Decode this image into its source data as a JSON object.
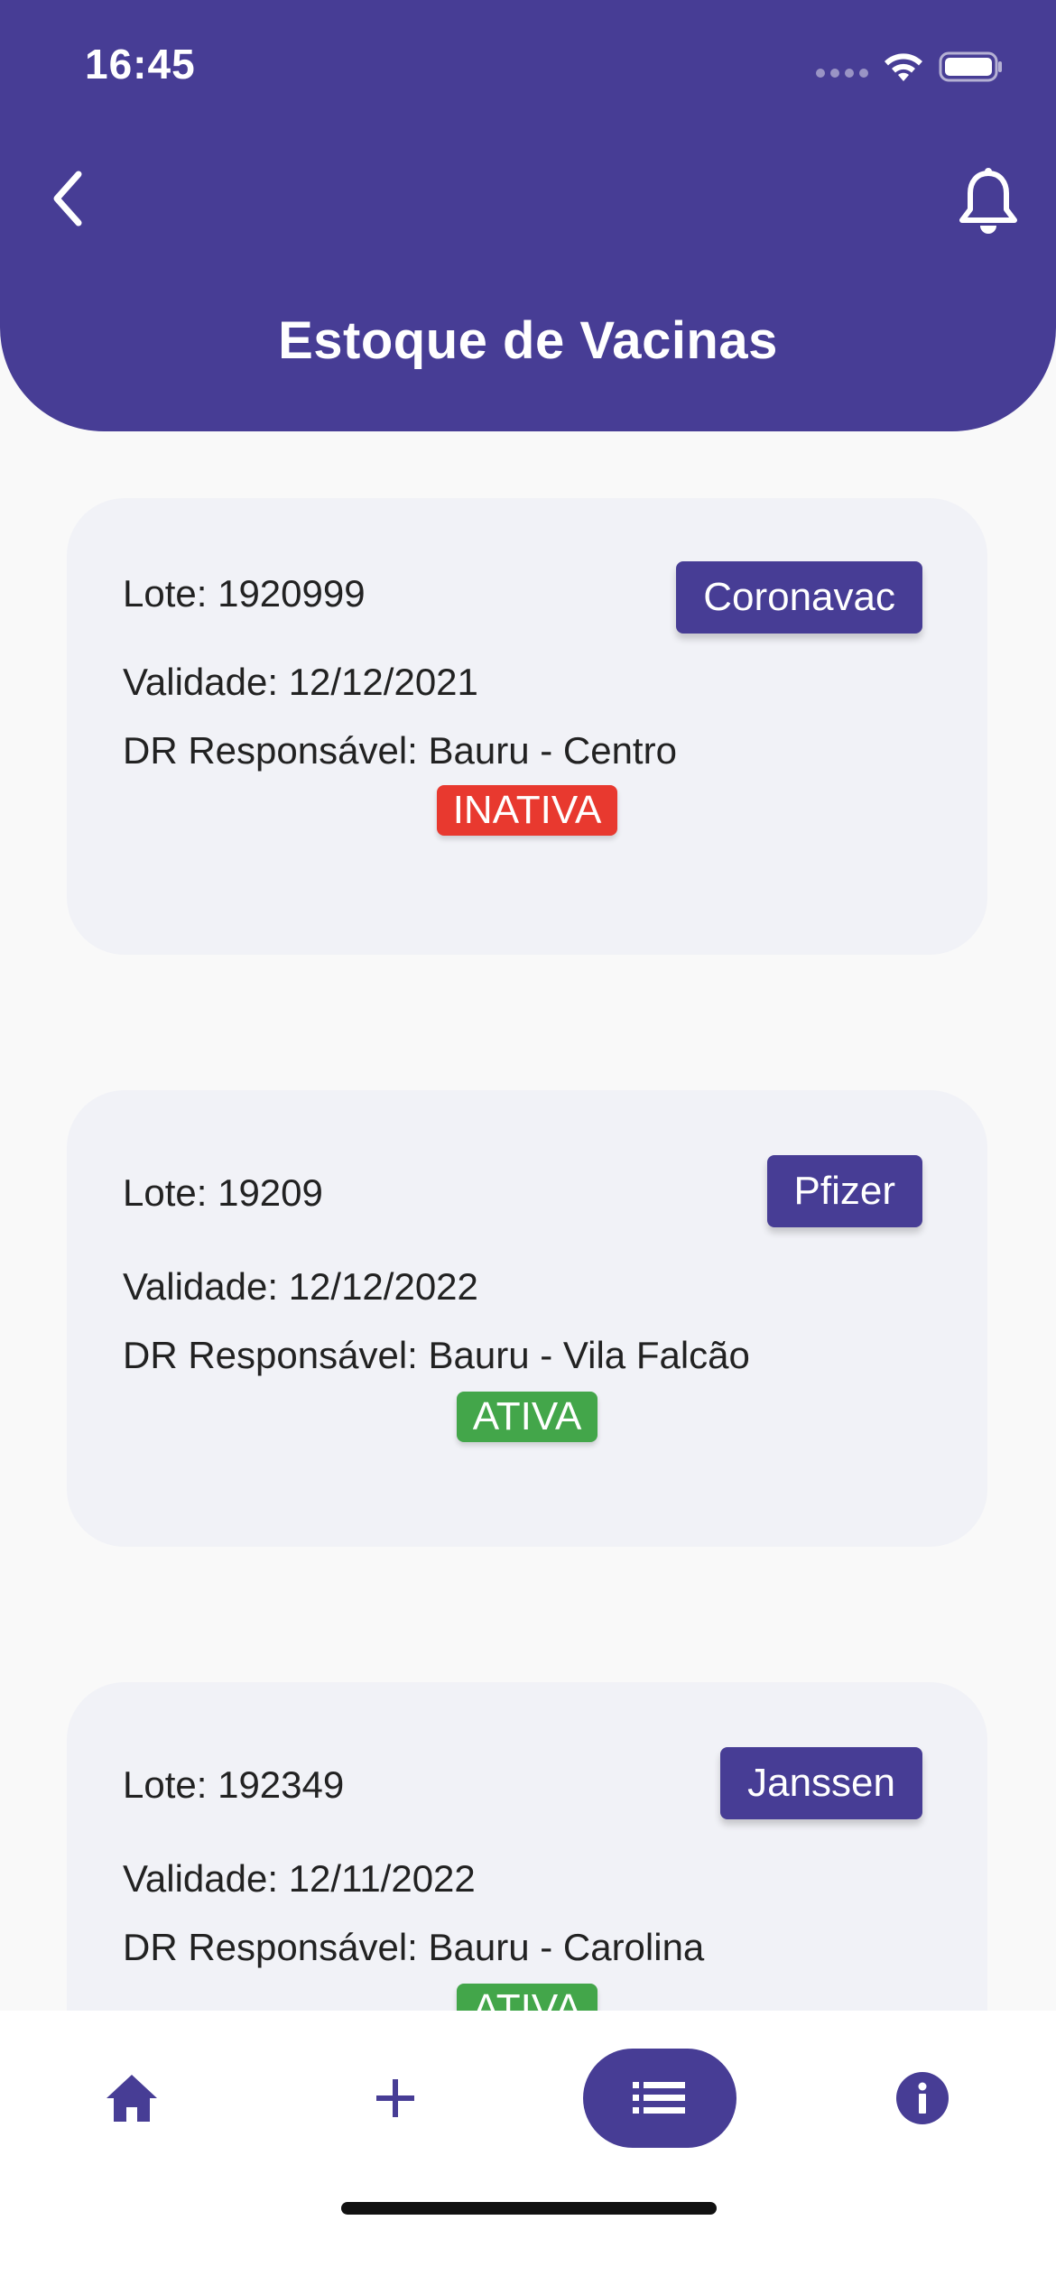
{
  "status_bar": {
    "time": "16:45"
  },
  "header": {
    "title": "Estoque de Vacinas",
    "back_icon": "chevron-left-icon",
    "notification_icon": "bell-icon"
  },
  "colors": {
    "primary": "#473d95",
    "inactive": "#e8392f",
    "active": "#43a64a",
    "card_background": "#f1f2f7"
  },
  "vaccines": [
    {
      "lote": "Lote: 1920999",
      "validade": "Validade: 12/12/2021",
      "dr": "DR Responsável: Bauru - Centro",
      "name": "Coronavac",
      "status": "INATIVA"
    },
    {
      "lote": "Lote: 19209",
      "validade": "Validade: 12/12/2022",
      "dr": "DR Responsável: Bauru - Vila Falcão",
      "name": "Pfizer",
      "status": "ATIVA"
    },
    {
      "lote": "Lote: 192349",
      "validade": "Validade: 12/11/2022",
      "dr": "DR Responsável: Bauru - Carolina",
      "name": "Janssen",
      "status": "ATIVA"
    }
  ],
  "bottom_nav": {
    "items": [
      {
        "icon": "home-icon",
        "selected": false
      },
      {
        "icon": "plus-icon",
        "selected": false
      },
      {
        "icon": "list-icon",
        "selected": true
      },
      {
        "icon": "info-icon",
        "selected": false
      }
    ]
  }
}
